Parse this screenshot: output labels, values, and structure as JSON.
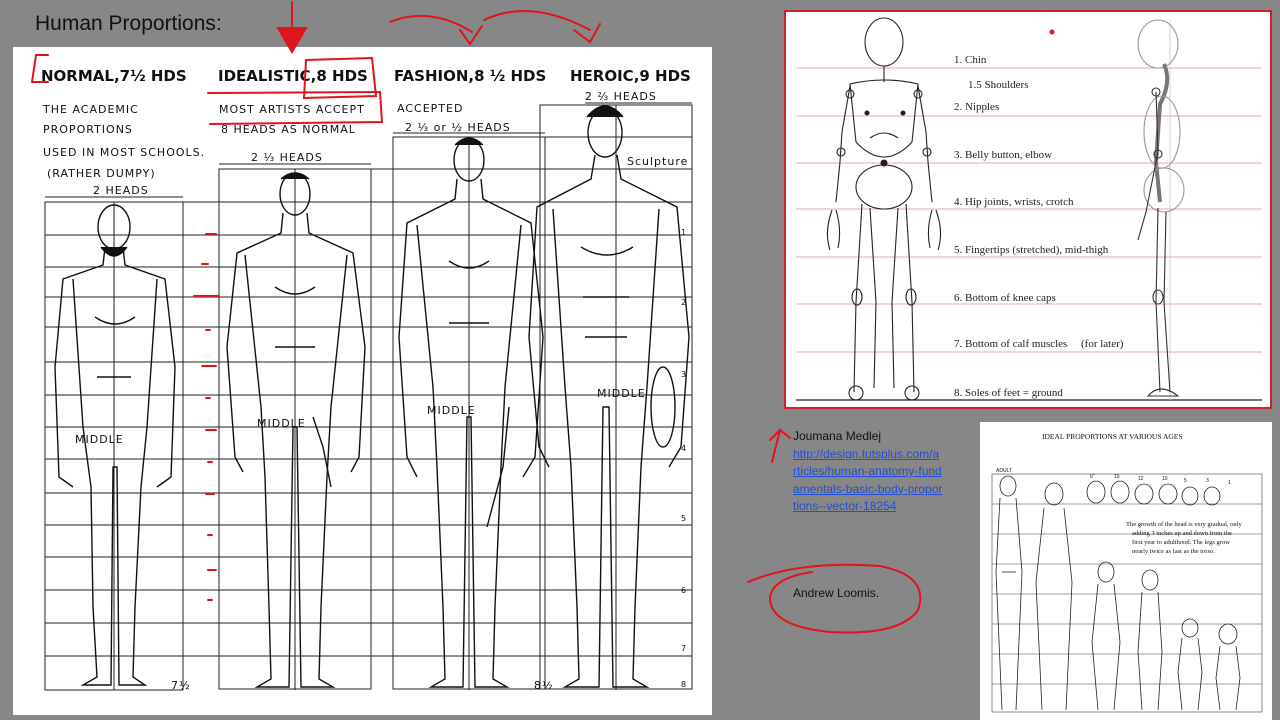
{
  "slide": {
    "title": "Human Proportions:"
  },
  "left_sheet": {
    "headers": [
      "NORMAL,7½ HDS",
      "IDEALISTIC,8 HDS",
      "FASHION,8 ½ HDS",
      "HEROIC,9 HDS"
    ],
    "normal_notes": [
      "THE ACADEMIC",
      "PROPORTIONS",
      "USED IN MOST SCHOOLS.",
      "(RATHER DUMPY)",
      "2 HEADS"
    ],
    "ideal_notes": [
      "MOST ARTISTS ACCEPT",
      "8 HEADS AS NORMAL",
      "2 ⅓ HEADS"
    ],
    "fashion_notes": [
      "ACCEPTED",
      "2 ⅓ or ½ HEADS"
    ],
    "heroic_notes": [
      "2 ⅔ HEADS",
      "Sculpture"
    ],
    "middle_label": "MIDDLE",
    "scale_numbers": [
      "1",
      "2",
      "3",
      "4",
      "5",
      "6",
      "7",
      "8"
    ],
    "bottom_fractions": [
      "7½",
      "8½"
    ]
  },
  "proportions_sheet": {
    "labels": [
      "1. Chin",
      "1.5 Shoulders",
      "2. Nipples",
      "3. Belly button, elbow",
      "4. Hip joints, wrists, crotch",
      "5. Fingertips (stretched), mid-thigh",
      "6. Bottom of knee caps",
      "7. Bottom of calf muscles",
      "8. Soles of feet = ground"
    ],
    "calf_note": "(for later)"
  },
  "credit": {
    "author": "Joumana Medlej",
    "url": "http://design.tutsplus.com/articles/human-anatomy-fundamentals-basic-body-proportions--vector-18254"
  },
  "loomis": "Andrew Loomis.",
  "ages_sheet": {
    "title": "IDEAL PROPORTIONS AT VARIOUS AGES",
    "note": [
      "The growth of the head is very gradual, only",
      "adding 3 inches up and down from the",
      "first year to adulthood. The legs grow",
      "nearly twice as fast as the torso."
    ],
    "age_labels": [
      "ADULT",
      "6\"",
      "15",
      "12",
      "10",
      "5",
      "3",
      "1"
    ]
  },
  "colors": {
    "background": "#878787",
    "annotation_red": "#e0141e",
    "link_blue": "#1f4fd6"
  }
}
